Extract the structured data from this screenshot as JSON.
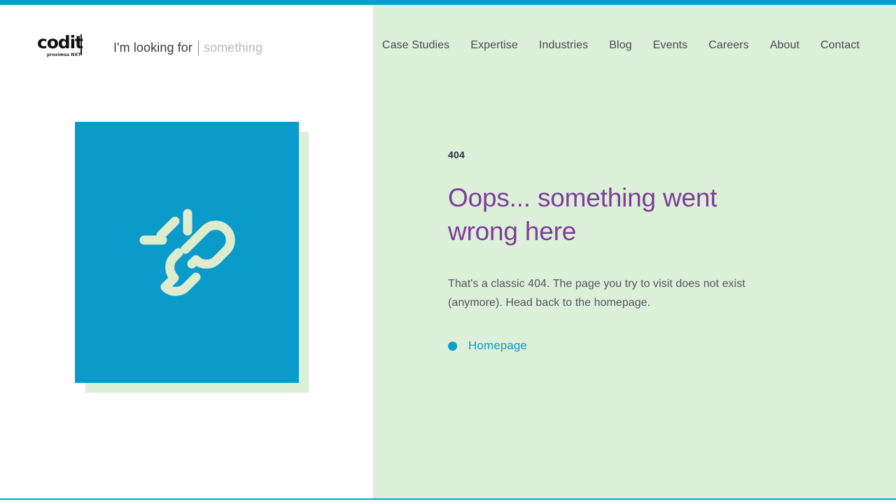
{
  "theme": {
    "accent_blue": "#0d9dcd",
    "card_blue": "#0b9bcb",
    "panel_green": "#dcefd9",
    "heading_purple": "#7d3f98",
    "body_gray": "#55565f",
    "icon_mint": "#dceccd"
  },
  "header": {
    "logo": {
      "wordmark": "codit",
      "tagline": "proximus NXT"
    },
    "search": {
      "prefix_label": "I'm looking for",
      "placeholder": "something",
      "value": ""
    },
    "nav": [
      {
        "label": "Case Studies"
      },
      {
        "label": "Expertise"
      },
      {
        "label": "Industries"
      },
      {
        "label": "Blog"
      },
      {
        "label": "Events"
      },
      {
        "label": "Careers"
      },
      {
        "label": "About"
      },
      {
        "label": "Contact"
      }
    ]
  },
  "illustration": {
    "icon_name": "broken-link-icon",
    "alt": "broken chain link with spark lines"
  },
  "error": {
    "code": "404",
    "headline": "Oops... something went wrong here",
    "body": "That's a classic 404. The page you try to visit does not exist (anymore). Head back to the homepage.",
    "link_label": "Homepage"
  }
}
